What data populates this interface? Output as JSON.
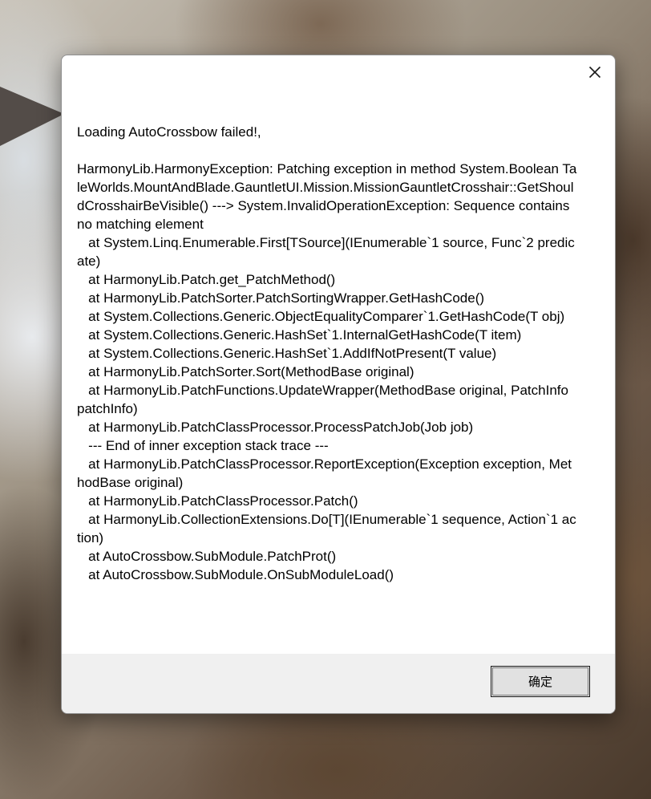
{
  "dialog": {
    "message_title": "Loading AutoCrossbow failed!,",
    "message_body": "HarmonyLib.HarmonyException: Patching exception in method System.Boolean TaleWorlds.MountAndBlade.GauntletUI.Mission.MissionGauntletCrosshair::GetShouldCrosshairBeVisible() ---> System.InvalidOperationException: Sequence contains no matching element\n   at System.Linq.Enumerable.First[TSource](IEnumerable`1 source, Func`2 predicate)\n   at HarmonyLib.Patch.get_PatchMethod()\n   at HarmonyLib.PatchSorter.PatchSortingWrapper.GetHashCode()\n   at System.Collections.Generic.ObjectEqualityComparer`1.GetHashCode(T obj)\n   at System.Collections.Generic.HashSet`1.InternalGetHashCode(T item)\n   at System.Collections.Generic.HashSet`1.AddIfNotPresent(T value)\n   at HarmonyLib.PatchSorter.Sort(MethodBase original)\n   at HarmonyLib.PatchFunctions.UpdateWrapper(MethodBase original, PatchInfo patchInfo)\n   at HarmonyLib.PatchClassProcessor.ProcessPatchJob(Job job)\n   --- End of inner exception stack trace ---\n   at HarmonyLib.PatchClassProcessor.ReportException(Exception exception, MethodBase original)\n   at HarmonyLib.PatchClassProcessor.Patch()\n   at HarmonyLib.CollectionExtensions.Do[T](IEnumerable`1 sequence, Action`1 action)\n   at AutoCrossbow.SubModule.PatchProt()\n   at AutoCrossbow.SubModule.OnSubModuleLoad()",
    "ok_label": "确定",
    "close_icon": "close-icon"
  }
}
